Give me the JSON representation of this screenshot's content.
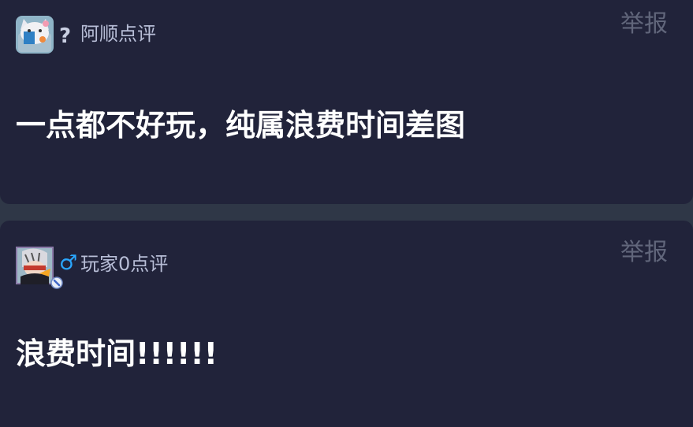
{
  "comments": [
    {
      "gender_symbol": "?",
      "username": "阿顺点评",
      "report_label": "举报",
      "text": "一点都不好玩，纯属浪费时间差图",
      "avatar_icon": "cat-avatar-icon"
    },
    {
      "gender_symbol": "♂",
      "username": "玩家0点评",
      "report_label": "举报",
      "text": "浪费时间!!!!!!",
      "avatar_icon": "anime-avatar-icon",
      "badge_icon": "verified-badge-icon"
    }
  ],
  "colors": {
    "page_background": "#2f3747",
    "card_background": "#21233a",
    "report_text": "#61667b",
    "username_text": "#b7bdd6",
    "male_symbol": "#2aa7ff"
  }
}
